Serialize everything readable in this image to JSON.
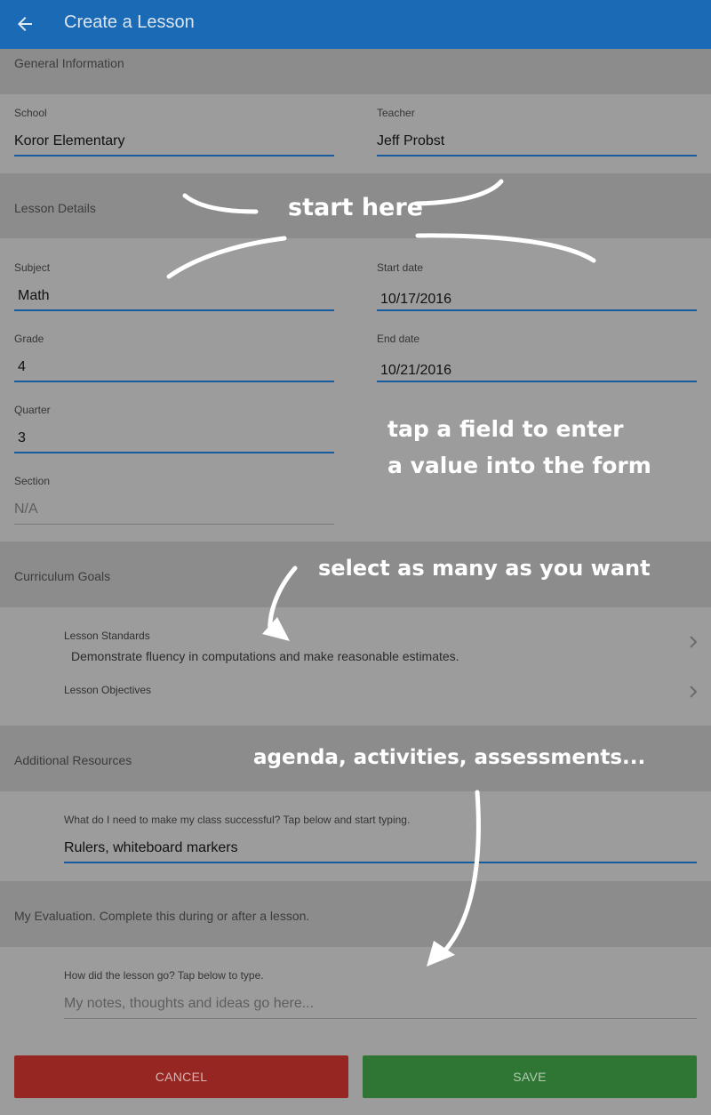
{
  "appbar": {
    "title": "Create a Lesson"
  },
  "sections": {
    "general": "General Information",
    "details": "Lesson Details",
    "curriculum": "Curriculum Goals",
    "resources": "Additional Resources",
    "evaluation": "My Evaluation. Complete this during or after a lesson."
  },
  "fields": {
    "school": {
      "label": "School",
      "value": "Koror Elementary"
    },
    "teacher": {
      "label": "Teacher",
      "value": "Jeff Probst"
    },
    "subject": {
      "label": "Subject",
      "value": "Math"
    },
    "start_date": {
      "label": "Start date",
      "value": "10/17/2016"
    },
    "grade": {
      "label": "Grade",
      "value": "4"
    },
    "end_date": {
      "label": "End date",
      "value": "10/21/2016"
    },
    "quarter": {
      "label": "Quarter",
      "value": "3"
    },
    "section": {
      "label": "Section",
      "placeholder": "N/A"
    }
  },
  "curriculum": {
    "standards": {
      "label": "Lesson Standards",
      "value": "Demonstrate fluency in computations and make reasonable estimates."
    },
    "objectives": {
      "label": "Lesson Objectives"
    }
  },
  "resources": {
    "label": "What do I need to make my class successful? Tap below and start typing.",
    "value": "Rulers, whiteboard markers"
  },
  "evaluation": {
    "label": "How did the lesson go? Tap below to type.",
    "placeholder": "My notes, thoughts and ideas go here..."
  },
  "buttons": {
    "cancel": "CANCEL",
    "save": "SAVE"
  },
  "annotations": {
    "start": "start here",
    "tap_line1": "tap a field to enter",
    "tap_line2": "a value into the form",
    "select": "select as many as you want",
    "agenda": "agenda, activities, assessments..."
  },
  "colors": {
    "appbar": "#1a6ab5",
    "accent": "#155b9e",
    "cancel": "#962622",
    "save": "#2f7533"
  },
  "icons": {
    "back": "arrow-left-icon",
    "chevron": "chevron-right-icon"
  }
}
